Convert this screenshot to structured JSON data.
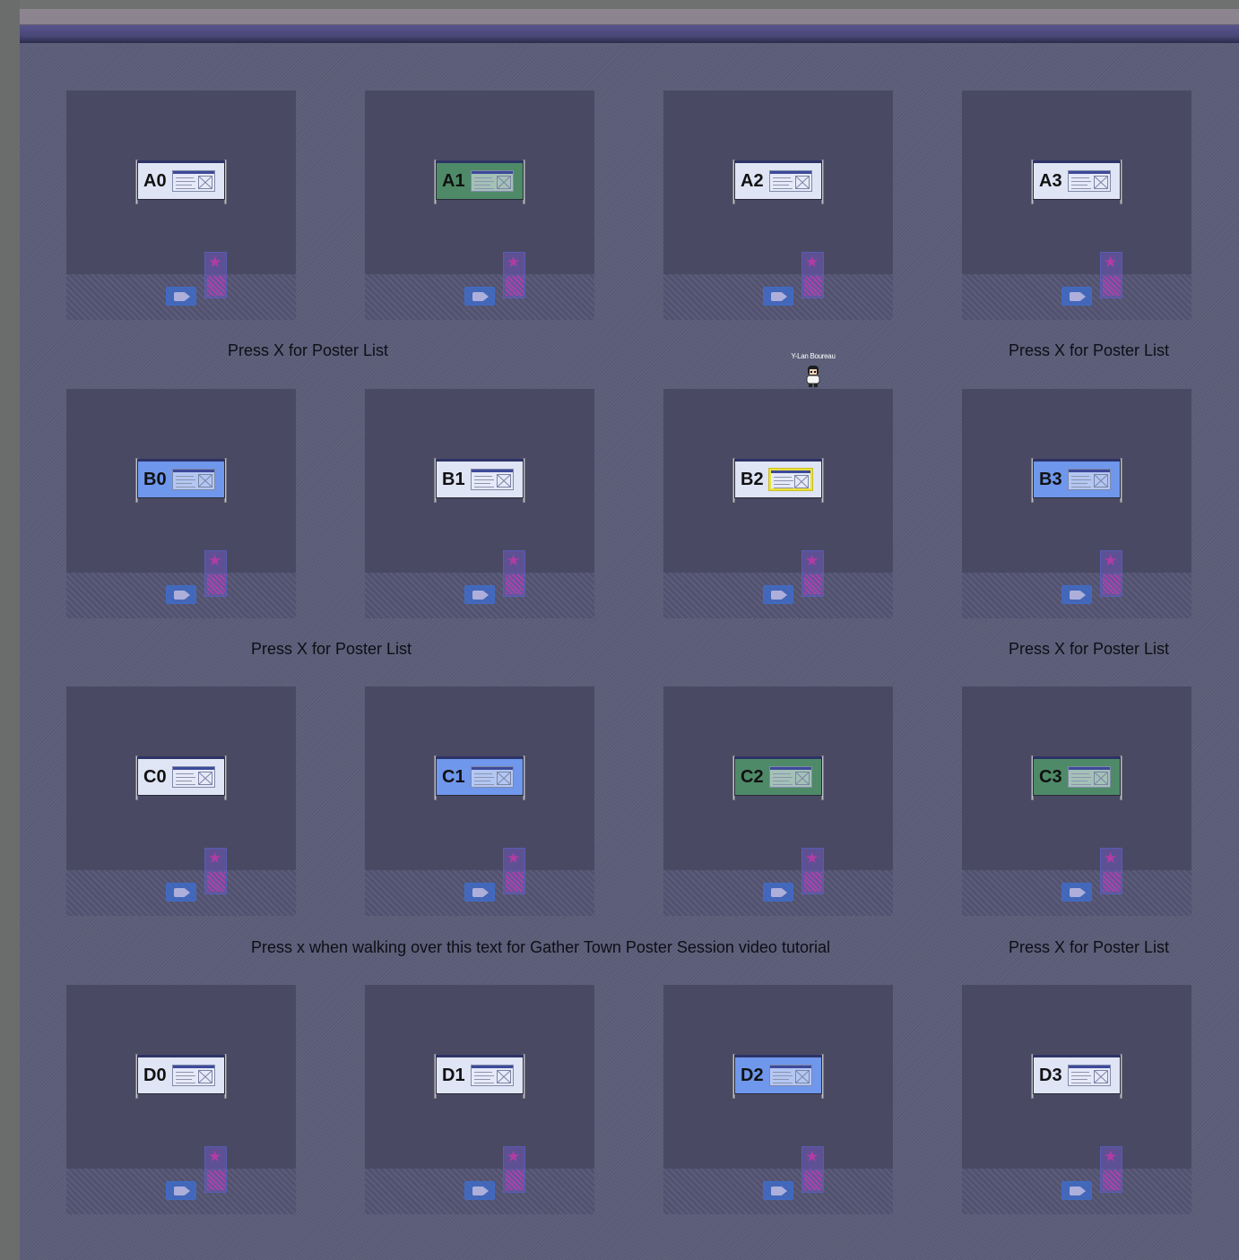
{
  "map": {
    "booths": [
      {
        "code": "A0",
        "board": "white",
        "highlighted": false
      },
      {
        "code": "A1",
        "board": "green",
        "highlighted": false
      },
      {
        "code": "A2",
        "board": "white",
        "highlighted": false
      },
      {
        "code": "A3",
        "board": "white",
        "highlighted": false
      },
      {
        "code": "B0",
        "board": "blue",
        "highlighted": false
      },
      {
        "code": "B1",
        "board": "white",
        "highlighted": false
      },
      {
        "code": "B2",
        "board": "white",
        "highlighted": true
      },
      {
        "code": "B3",
        "board": "blue",
        "highlighted": false
      },
      {
        "code": "C0",
        "board": "white",
        "highlighted": false
      },
      {
        "code": "C1",
        "board": "blue",
        "highlighted": false
      },
      {
        "code": "C2",
        "board": "green",
        "highlighted": false
      },
      {
        "code": "C3",
        "board": "green",
        "highlighted": false
      },
      {
        "code": "D0",
        "board": "white",
        "highlighted": false
      },
      {
        "code": "D1",
        "board": "white",
        "highlighted": false
      },
      {
        "code": "D2",
        "board": "blue",
        "highlighted": false
      },
      {
        "code": "D3",
        "board": "white",
        "highlighted": false
      }
    ],
    "floor_texts": [
      "Press X for Poster List",
      "Press X for Poster List",
      "Press X for Poster List",
      "Press X for Poster List",
      "Press x when walking over this text for Gather Town Poster Session video tutorial",
      "Press X for Poster List"
    ],
    "avatar": {
      "name": "Y-Lan Boureau"
    },
    "icons": {
      "booth_stand": "star-icon",
      "booth_camera": "video-camera-icon"
    },
    "colors": {
      "board_white": "#dfe5f5",
      "board_green": "#4e8a68",
      "board_blue": "#6f97ec",
      "highlight": "#ece23a",
      "floor": "#5a5b76",
      "booth": "#4a4963"
    }
  }
}
